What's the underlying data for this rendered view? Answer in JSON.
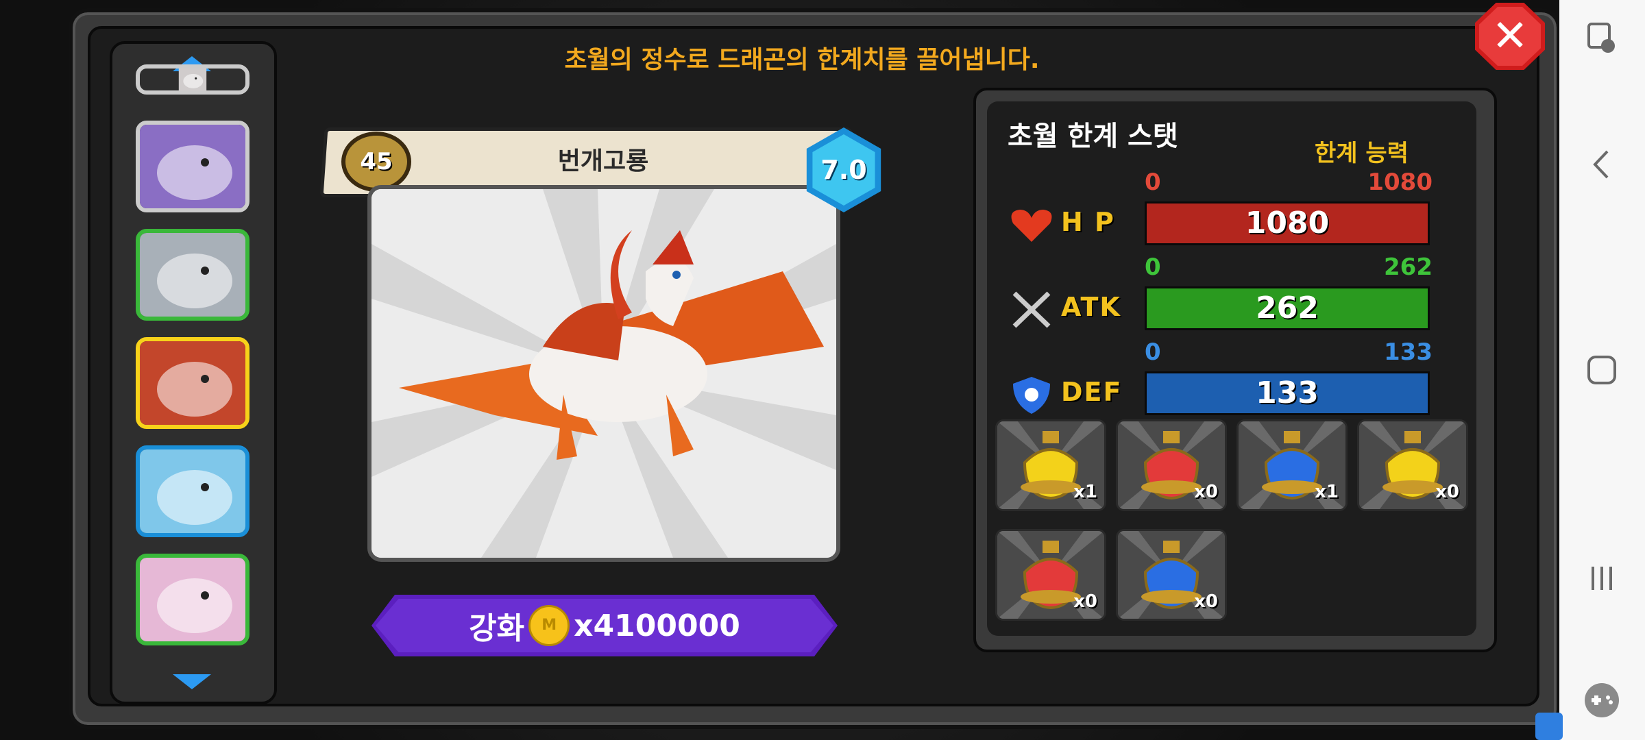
{
  "title": "초월의 정수로 드래곤의 한계치를 끌어냅니다.",
  "close_icon": "close-icon",
  "sidebar": {
    "items": [
      {
        "name": "dragon-partial",
        "border": "#cccccc"
      },
      {
        "name": "dragon-blue-orange",
        "border": "#cccccc"
      },
      {
        "name": "dragon-grey",
        "border": "#3ab83a"
      },
      {
        "name": "dragon-red-white",
        "border": "#f7d21a"
      },
      {
        "name": "dragon-ice",
        "border": "#1a8fd8"
      },
      {
        "name": "dragon-pink",
        "border": "#3ab83a"
      }
    ]
  },
  "dragon": {
    "level": "45",
    "name": "번개고룡",
    "grade": "7.0"
  },
  "upgrade": {
    "label": "강화",
    "coin_symbol": "M",
    "cost": "x4100000"
  },
  "stats": {
    "title": "초월 한계 스탯",
    "limit_label": "한계 능력",
    "rows": [
      {
        "name": "H P",
        "min": "0",
        "max": "1080",
        "value": "1080",
        "fill": 1.0,
        "color": "#b3261e",
        "label_color": "#e34a3a",
        "icon": "heart-icon"
      },
      {
        "name": "ATK",
        "min": "0",
        "max": "262",
        "value": "262",
        "fill": 1.0,
        "color": "#2a9a1f",
        "label_color": "#3ec43a",
        "icon": "swords-icon"
      },
      {
        "name": "DEF",
        "min": "0",
        "max": "133",
        "value": "133",
        "fill": 1.0,
        "color": "#1d5fb0",
        "label_color": "#3a8ee3",
        "icon": "shield-icon"
      }
    ]
  },
  "items": [
    {
      "color": "#f3d21a",
      "count": "x1",
      "icon": "yellow-potion-icon"
    },
    {
      "color": "#e33a3a",
      "count": "x0",
      "icon": "red-potion-icon"
    },
    {
      "color": "#2a6ee3",
      "count": "x1",
      "icon": "blue-potion-icon"
    },
    {
      "color": "#f3d21a",
      "count": "x0",
      "icon": "yellow-large-potion-icon"
    },
    {
      "color": "#e33a3a",
      "count": "x0",
      "icon": "red-large-potion-icon"
    },
    {
      "color": "#2a6ee3",
      "count": "x0",
      "icon": "blue-large-potion-icon"
    }
  ]
}
